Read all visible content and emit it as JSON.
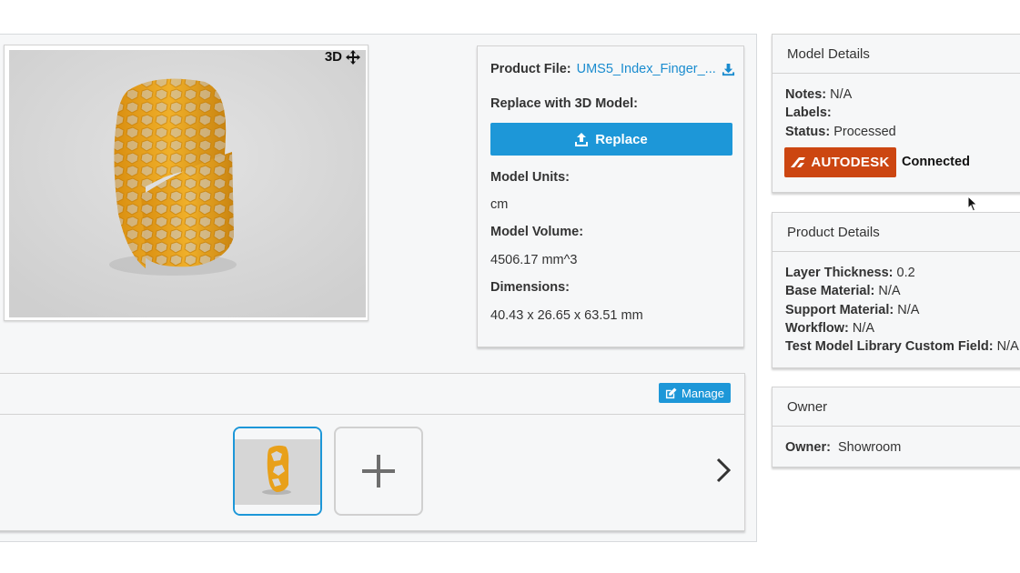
{
  "viewer": {
    "mode_label": "3D"
  },
  "file_card": {
    "product_file_label": "Product File:",
    "product_file_name": "UMS5_Index_Finger_...",
    "replace_label": "Replace with 3D Model:",
    "replace_button": "Replace",
    "units_label": "Model Units:",
    "units_value": "cm",
    "volume_label": "Model Volume:",
    "volume_value": "4506.17 mm^3",
    "dimensions_label": "Dimensions:",
    "dimensions_value": "40.43 x 26.65 x 63.51 mm"
  },
  "gallery": {
    "manage_button": "Manage"
  },
  "model_details": {
    "title": "Model Details",
    "notes_label": "Notes:",
    "notes_value": "N/A",
    "labels_label": "Labels:",
    "labels_value": "",
    "status_label": "Status:",
    "status_value": "Processed",
    "autodesk_label": "AUTODESK",
    "connection_status": "Connected"
  },
  "product_details": {
    "title": "Product Details",
    "layer_label": "Layer Thickness:",
    "layer_value": "0.2",
    "base_label": "Base Material:",
    "base_value": "N/A",
    "support_label": "Support Material:",
    "support_value": "N/A",
    "workflow_label": "Workflow:",
    "workflow_value": "N/A",
    "custom_label": "Test Model Library Custom Field:",
    "custom_value": "N/A"
  },
  "owner": {
    "title": "Owner",
    "owner_label": "Owner:",
    "owner_value": "Showroom"
  },
  "colors": {
    "accent": "#1d97d8",
    "autodesk": "#cc4611",
    "model": "#e8a01a"
  }
}
